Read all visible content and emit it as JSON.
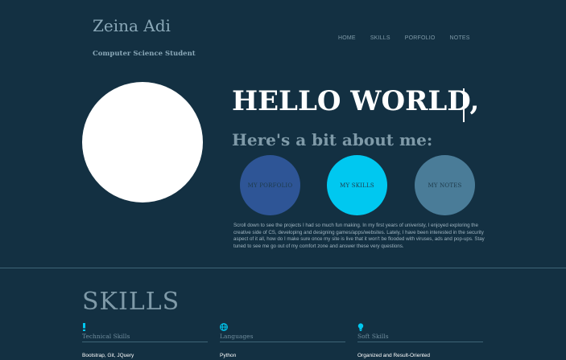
{
  "header": {
    "name": "Zeina Adi",
    "subtitle": "Computer Science Student"
  },
  "nav": {
    "items": [
      {
        "label": "HOME"
      },
      {
        "label": "SKILLS"
      },
      {
        "label": "PORFOLIO"
      },
      {
        "label": "NOTES"
      }
    ]
  },
  "hero": {
    "headline": "HELLO WORLD,",
    "subheadline": "Here's a bit about me:",
    "buttons": [
      {
        "label": "MY PORFOLIO",
        "color": "#2e5596"
      },
      {
        "label": "MY SKILLS",
        "color": "#00c8f0"
      },
      {
        "label": "MY NOTES",
        "color": "#4a7c98"
      }
    ],
    "bio": "Scroll down to see the projects I had so much fun making. In my first years of univeristy, I enjoyed exploring the creative side of CS, developing and designing games/apps/websites. Lately, I have been interested in the security aspect of it all, how do I make sure once my site is live that it won't be flooded with viruses, ads and pop-ups. Stay tuned to see me go out of my comfort zone and answer these very questions."
  },
  "skills": {
    "title": "SKILLS",
    "columns": [
      {
        "icon": "exclamation-icon",
        "heading": "Technical Skills",
        "first_item": "Bootstrap, Git, JQuery"
      },
      {
        "icon": "globe-icon",
        "heading": "Languages",
        "first_item": "Python"
      },
      {
        "icon": "lightbulb-icon",
        "heading": "Soft Skills",
        "first_item": "Organized and Result-Oriented"
      }
    ]
  },
  "colors": {
    "background": "#133042",
    "accent": "#00c8f0",
    "muted_text": "#7f9aa8"
  }
}
